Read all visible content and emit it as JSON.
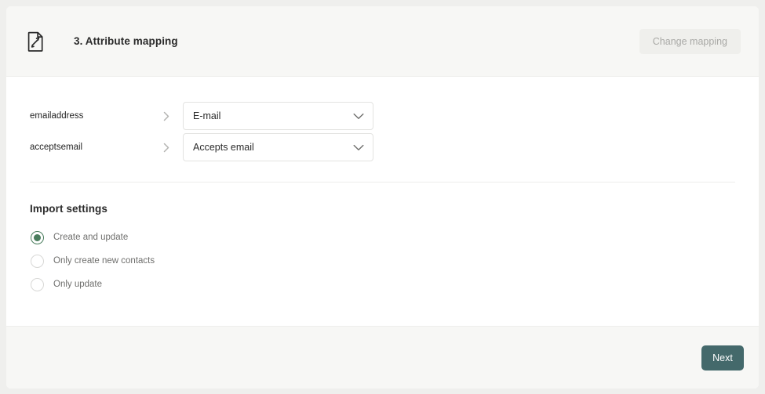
{
  "colors": {
    "page_background": "#efefed",
    "card_background": "#ffffff",
    "panel_background": "#f7f7f5",
    "accent_green": "#4a7d5d",
    "primary_button": "#44696b",
    "border": "#e3e3e1",
    "muted_text": "#6f6f6d",
    "disabled_text": "#a9a9a6"
  },
  "header": {
    "icon": "document-edit-icon",
    "title": "3. Attribute mapping",
    "change_mapping_label": "Change mapping",
    "change_mapping_disabled": true
  },
  "mapping": {
    "arrow_icon": "chevron-right-icon",
    "dropdown_icon": "chevron-down-icon",
    "rows": [
      {
        "source": "emailaddress",
        "target": "E-mail"
      },
      {
        "source": "acceptsemail",
        "target": "Accepts email"
      }
    ]
  },
  "import_settings": {
    "title": "Import settings",
    "options": [
      {
        "label": "Create and update",
        "selected": true
      },
      {
        "label": "Only create new contacts",
        "selected": false
      },
      {
        "label": "Only update",
        "selected": false
      }
    ]
  },
  "footer": {
    "next_label": "Next"
  }
}
